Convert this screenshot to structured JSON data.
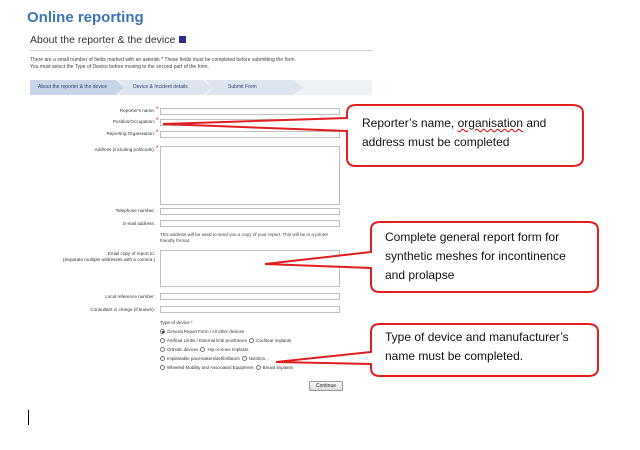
{
  "page": {
    "heading": "Online reporting"
  },
  "section": {
    "title": "About the reporter & the device",
    "intro_line1_a": "There are a small number of fields marked with an asterisk ",
    "intro_line1_asterisk": "*",
    "intro_line1_b": " These fields must be completed before submitting the form.",
    "intro_line2": "You must select the Type of Device before moving to the second part of the form."
  },
  "steps": [
    {
      "label": "About the reporter & the device"
    },
    {
      "label": "Device & Incident details"
    },
    {
      "label": "Submit Form"
    }
  ],
  "form": {
    "reporters_name_label": "Reporter's name:",
    "position_label": "Position/Occupation:",
    "organisation_label": "Reporting Organisation:",
    "address_label": "Address (including postcode):",
    "telephone_label": "Telephone number:",
    "email_label": "E-mail address:",
    "email_note": "This address will be used to send you a copy of your report. This will be in a printer friendly format.",
    "email_copy_label_1": "Email copy of report to:",
    "email_copy_label_2": "(Separate multiple addresses with a comma.)",
    "local_ref_label": "Local reference number:",
    "consultant_label": "Consultant in charge (if known):",
    "required_marker": "*",
    "device_type_label": "Type of device",
    "device_options": {
      "general": "General Report Form / All other devices",
      "artificial_limbs": "Artificial Limbs / External limb prostheses",
      "cochlear": "Cochlear implants",
      "orthotic": "Orthotic devices",
      "hip_knee": "Hip or Knee Implants",
      "pacemakers": "Implantable pacemakers/defibrillators",
      "other": "Nutrition...",
      "wheeled": "Wheeled Mobility and Associated Equipment",
      "breast": "Breast implants"
    },
    "continue_label": "Continue"
  },
  "callouts": [
    {
      "line1_a": "Reporter’s name, ",
      "line1_spell": "organisation",
      "line1_b": " and",
      "line2": "address must be completed"
    },
    {
      "line1": "Complete general report form for",
      "line2": "synthetic meshes for incontinence",
      "line3": "and prolapse"
    },
    {
      "line1": "Type of device and manufacturer’s",
      "line2": "name must be completed."
    }
  ],
  "colors": {
    "heading": "#3d74b6",
    "callout_border": "#e02020",
    "required": "#cc0000"
  }
}
